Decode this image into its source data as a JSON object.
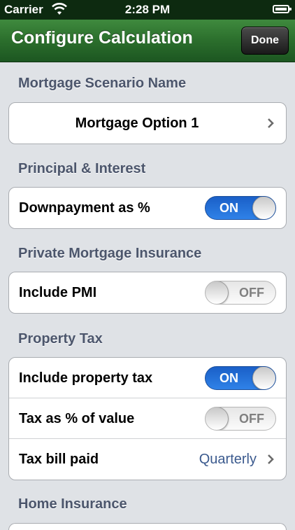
{
  "status_bar": {
    "carrier": "Carrier",
    "time": "2:28 PM"
  },
  "nav": {
    "title": "Configure Calculation",
    "done_label": "Done"
  },
  "sections": [
    {
      "header": "Mortgage Scenario Name",
      "rows": [
        {
          "label": "Mortgage Option 1"
        }
      ]
    },
    {
      "header": "Principal & Interest",
      "rows": [
        {
          "label": "Downpayment as %",
          "toggle": "ON"
        }
      ]
    },
    {
      "header": "Private Mortgage Insurance",
      "rows": [
        {
          "label": "Include PMI",
          "toggle": "OFF"
        }
      ]
    },
    {
      "header": "Property Tax",
      "rows": [
        {
          "label": "Include property tax",
          "toggle": "ON"
        },
        {
          "label": "Tax as % of value",
          "toggle": "OFF"
        },
        {
          "label": "Tax bill paid",
          "value": "Quarterly"
        }
      ]
    },
    {
      "header": "Home Insurance",
      "rows": []
    }
  ],
  "colors": {
    "nav_green": "#2b6e2c",
    "toggle_on_blue": "#2f82e8",
    "section_header": "#4c566c",
    "value_blue": "#3b5a8e"
  }
}
